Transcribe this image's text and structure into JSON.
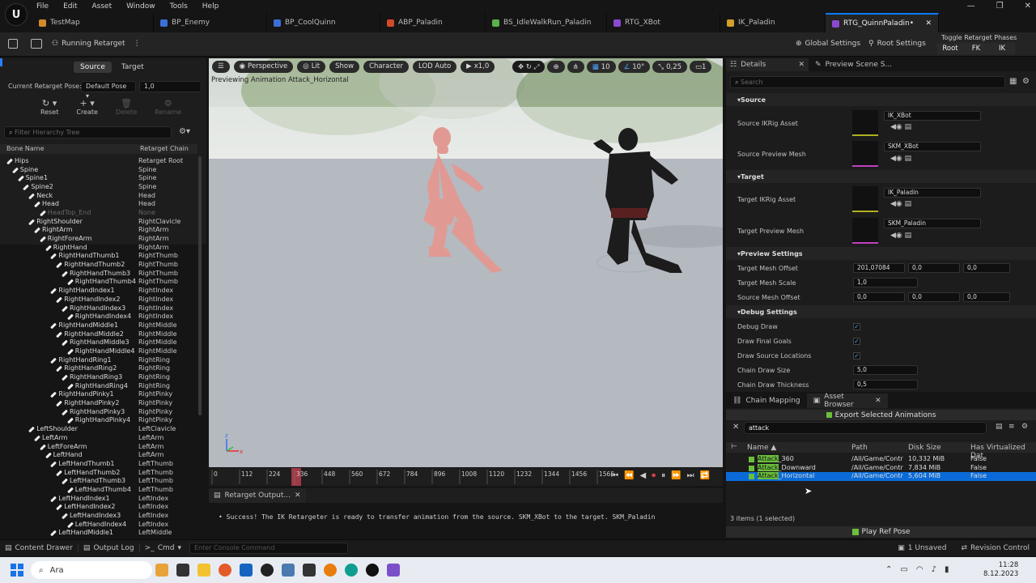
{
  "menu": [
    "File",
    "Edit",
    "Asset",
    "Window",
    "Tools",
    "Help"
  ],
  "tabs": [
    {
      "label": "TestMap",
      "color": "#d08a2a",
      "active": false
    },
    {
      "label": "BP_Enemy",
      "color": "#3c6fd8",
      "active": false
    },
    {
      "label": "BP_CoolQuinn",
      "color": "#3c6fd8",
      "active": false
    },
    {
      "label": "ABP_Paladin",
      "color": "#d04a2a",
      "active": false
    },
    {
      "label": "BS_IdleWalkRun_Paladin",
      "color": "#5ab04a",
      "active": false
    },
    {
      "label": "RTG_XBot",
      "color": "#8a4ad0",
      "active": false
    },
    {
      "label": "IK_Paladin",
      "color": "#d0a02a",
      "active": false
    },
    {
      "label": "RTG_QuinnPaladin•",
      "color": "#8a4ad0",
      "active": true
    }
  ],
  "toolbar": {
    "running": "Running Retarget",
    "global": "Global Settings",
    "root": "Root Settings",
    "phases_title": "Toggle Retarget Phases",
    "phases": [
      "Root",
      "FK",
      "IK"
    ]
  },
  "left": {
    "tab_source": "Source",
    "tab_target": "Target",
    "pose_label": "Current Retarget Pose:",
    "pose_value": "Default Pose",
    "pose_num": "1,0",
    "actions": [
      "Reset",
      "Create",
      "Delete",
      "Rename"
    ],
    "filter_placeholder": "Filter Hierarchy Tree",
    "col_bone": "Bone Name",
    "col_chain": "Retarget Chain",
    "bones": [
      {
        "n": "Hips",
        "d": 0,
        "c": "Retarget Root"
      },
      {
        "n": "Spine",
        "d": 1,
        "c": "Spine"
      },
      {
        "n": "Spine1",
        "d": 2,
        "c": "Spine"
      },
      {
        "n": "Spine2",
        "d": 3,
        "c": "Spine"
      },
      {
        "n": "Neck",
        "d": 4,
        "c": "Head"
      },
      {
        "n": "Head",
        "d": 5,
        "c": "Head"
      },
      {
        "n": "HeadTop_End",
        "d": 6,
        "c": "None",
        "dim": true
      },
      {
        "n": "RightShoulder",
        "d": 4,
        "c": "RightClavicle"
      },
      {
        "n": "RightArm",
        "d": 5,
        "c": "RightArm"
      },
      {
        "n": "RightForeArm",
        "d": 6,
        "c": "RightArm"
      },
      {
        "n": "RightHand",
        "d": 7,
        "c": "RightArm"
      },
      {
        "n": "RightHandThumb1",
        "d": 8,
        "c": "RightThumb"
      },
      {
        "n": "RightHandThumb2",
        "d": 9,
        "c": "RightThumb"
      },
      {
        "n": "RightHandThumb3",
        "d": 10,
        "c": "RightThumb"
      },
      {
        "n": "RightHandThumb4",
        "d": 11,
        "c": "RightThumb"
      },
      {
        "n": "RightHandIndex1",
        "d": 8,
        "c": "RightIndex"
      },
      {
        "n": "RightHandIndex2",
        "d": 9,
        "c": "RightIndex"
      },
      {
        "n": "RightHandIndex3",
        "d": 10,
        "c": "RightIndex"
      },
      {
        "n": "RightHandIndex4",
        "d": 11,
        "c": "RightIndex"
      },
      {
        "n": "RightHandMiddle1",
        "d": 8,
        "c": "RightMiddle"
      },
      {
        "n": "RightHandMiddle2",
        "d": 9,
        "c": "RightMiddle"
      },
      {
        "n": "RightHandMiddle3",
        "d": 10,
        "c": "RightMiddle"
      },
      {
        "n": "RightHandMiddle4",
        "d": 11,
        "c": "RightMiddle"
      },
      {
        "n": "RightHandRing1",
        "d": 8,
        "c": "RightRing"
      },
      {
        "n": "RightHandRing2",
        "d": 9,
        "c": "RightRing"
      },
      {
        "n": "RightHandRing3",
        "d": 10,
        "c": "RightRing"
      },
      {
        "n": "RightHandRing4",
        "d": 11,
        "c": "RightRing"
      },
      {
        "n": "RightHandPinky1",
        "d": 8,
        "c": "RightPinky"
      },
      {
        "n": "RightHandPinky2",
        "d": 9,
        "c": "RightPinky"
      },
      {
        "n": "RightHandPinky3",
        "d": 10,
        "c": "RightPinky"
      },
      {
        "n": "RightHandPinky4",
        "d": 11,
        "c": "RightPinky"
      },
      {
        "n": "LeftShoulder",
        "d": 4,
        "c": "LeftClavicle"
      },
      {
        "n": "LeftArm",
        "d": 5,
        "c": "LeftArm"
      },
      {
        "n": "LeftForeArm",
        "d": 6,
        "c": "LeftArm"
      },
      {
        "n": "LeftHand",
        "d": 7,
        "c": "LeftArm"
      },
      {
        "n": "LeftHandThumb1",
        "d": 8,
        "c": "LeftThumb"
      },
      {
        "n": "LeftHandThumb2",
        "d": 9,
        "c": "LeftThumb"
      },
      {
        "n": "LeftHandThumb3",
        "d": 10,
        "c": "LeftThumb"
      },
      {
        "n": "LeftHandThumb4",
        "d": 11,
        "c": "LeftThumb"
      },
      {
        "n": "LeftHandIndex1",
        "d": 8,
        "c": "LeftIndex"
      },
      {
        "n": "LeftHandIndex2",
        "d": 9,
        "c": "LeftIndex"
      },
      {
        "n": "LeftHandIndex3",
        "d": 10,
        "c": "LeftIndex"
      },
      {
        "n": "LeftHandIndex4",
        "d": 11,
        "c": "LeftIndex"
      },
      {
        "n": "LeftHandMiddle1",
        "d": 8,
        "c": "LeftMiddle"
      }
    ]
  },
  "viewport": {
    "buttons": [
      "Perspective",
      "Lit",
      "Show",
      "Character",
      "LOD Auto",
      "x1,0"
    ],
    "right": [
      "10",
      "10°",
      "0,25"
    ],
    "preview": "Previewing Animation Attack_Horizontal",
    "ticks": [
      "0",
      "112",
      "224",
      "336",
      "448",
      "560",
      "672",
      "784",
      "896",
      "1008",
      "1120",
      "1232",
      "1344",
      "1456",
      "1568"
    ],
    "playhead": "336"
  },
  "output": {
    "tab": "Retarget Output...",
    "message": "• Success! The IK Retargeter is ready to transfer animation from the source. SKM_XBot to the target. SKM_Paladin"
  },
  "details": {
    "tab1": "Details",
    "tab2": "Preview Scene S...",
    "search_placeholder": "Search",
    "sections": {
      "source": "Source",
      "target": "Target",
      "preview": "Preview Settings",
      "debug": "Debug Settings"
    },
    "src_ikrig_label": "Source IKRig Asset",
    "src_ikrig": "IK_XBot",
    "src_mesh_label": "Source Preview Mesh",
    "src_mesh": "SKM_XBot",
    "tgt_ikrig_label": "Target IKRig Asset",
    "tgt_ikrig": "IK_Paladin",
    "tgt_mesh_label": "Target Preview Mesh",
    "tgt_mesh": "SKM_Paladin",
    "tmo_label": "Target Mesh Offset",
    "tmo": [
      "201,07084",
      "0,0",
      "0,0"
    ],
    "tms_label": "Target Mesh Scale",
    "tms": "1,0",
    "smo_label": "Source Mesh Offset",
    "smo": [
      "0,0",
      "0,0",
      "0,0"
    ],
    "debug_draw": "Debug Draw",
    "draw_goals": "Draw Final Goals",
    "draw_src": "Draw Source Locations",
    "chain_size_label": "Chain Draw Size",
    "chain_size": "5,0",
    "chain_thick_label": "Chain Draw Thickness",
    "chain_thick": "0,5"
  },
  "browser": {
    "tab1": "Chain Mapping",
    "tab2": "Asset Browser",
    "export": "Export Selected Animations",
    "search": "attack",
    "cols": [
      "Name",
      "Path",
      "Disk Size",
      "Has Virtualized Dat"
    ],
    "rows": [
      {
        "hl": "Attack",
        "rest": "_360",
        "path": "/All/Game/Contr",
        "size": "10,332 MiB",
        "virt": "False",
        "sel": false
      },
      {
        "hl": "Attack",
        "rest": "_Downward",
        "path": "/All/Game/Contr",
        "size": "7,834 MiB",
        "virt": "False",
        "sel": false
      },
      {
        "hl": "Attack",
        "rest": "_Horizontal",
        "path": "/All/Game/Contr",
        "size": "5,604 MiB",
        "virt": "False",
        "sel": true
      }
    ],
    "count": "3 items (1 selected)",
    "play": "Play Ref Pose"
  },
  "status": {
    "content": "Content Drawer",
    "outlog": "Output Log",
    "cmd": "Cmd",
    "console_placeholder": "Enter Console Command",
    "unsaved": "1 Unsaved",
    "revision": "Revision Control"
  },
  "taskbar": {
    "search": "Ara",
    "time": "11:28",
    "date": "8.12.2023"
  }
}
